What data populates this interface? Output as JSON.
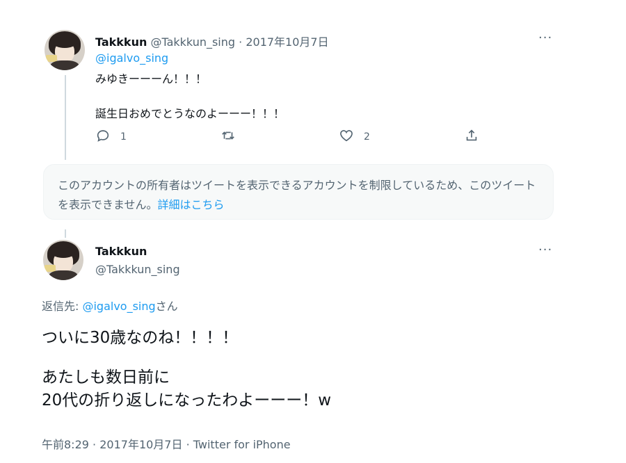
{
  "tweet1": {
    "display_name": "Takkkun",
    "handle": "@Takkkun_sing",
    "separator": "·",
    "date": "2017年10月7日",
    "mention": "@igalvo_sing",
    "line1": "みゆきーーーん！！！",
    "line2": "誕生日おめでとうなのよーーー！！！",
    "reply_count": "1",
    "like_count": "2",
    "more": "···"
  },
  "notice": {
    "text": "このアカウントの所有者はツイートを表示できるアカウントを制限しているため、このツイートを表示できません。",
    "link": "詳細はこちら"
  },
  "tweet2": {
    "display_name": "Takkkun",
    "handle": "@Takkkun_sing",
    "more": "···",
    "reply_prefix": "返信先: ",
    "reply_mention": "@igalvo_sing",
    "reply_suffix": "さん",
    "body_line1": "ついに30歳なのね！！！！",
    "body_line2": "あたしも数日前に",
    "body_line3": "20代の折り返しになったわよーーー！w",
    "time": "午前8:29",
    "separator": "·",
    "date": "2017年10月7日",
    "source": "Twitter for iPhone"
  },
  "icons": {
    "reply": "reply-icon",
    "retweet": "retweet-icon",
    "like": "heart-icon",
    "share": "share-icon",
    "more": "more-icon"
  },
  "colors": {
    "link": "#1d9bf0",
    "muted": "#536471",
    "text": "#0f1419",
    "notice_bg": "#f7f9f9"
  }
}
